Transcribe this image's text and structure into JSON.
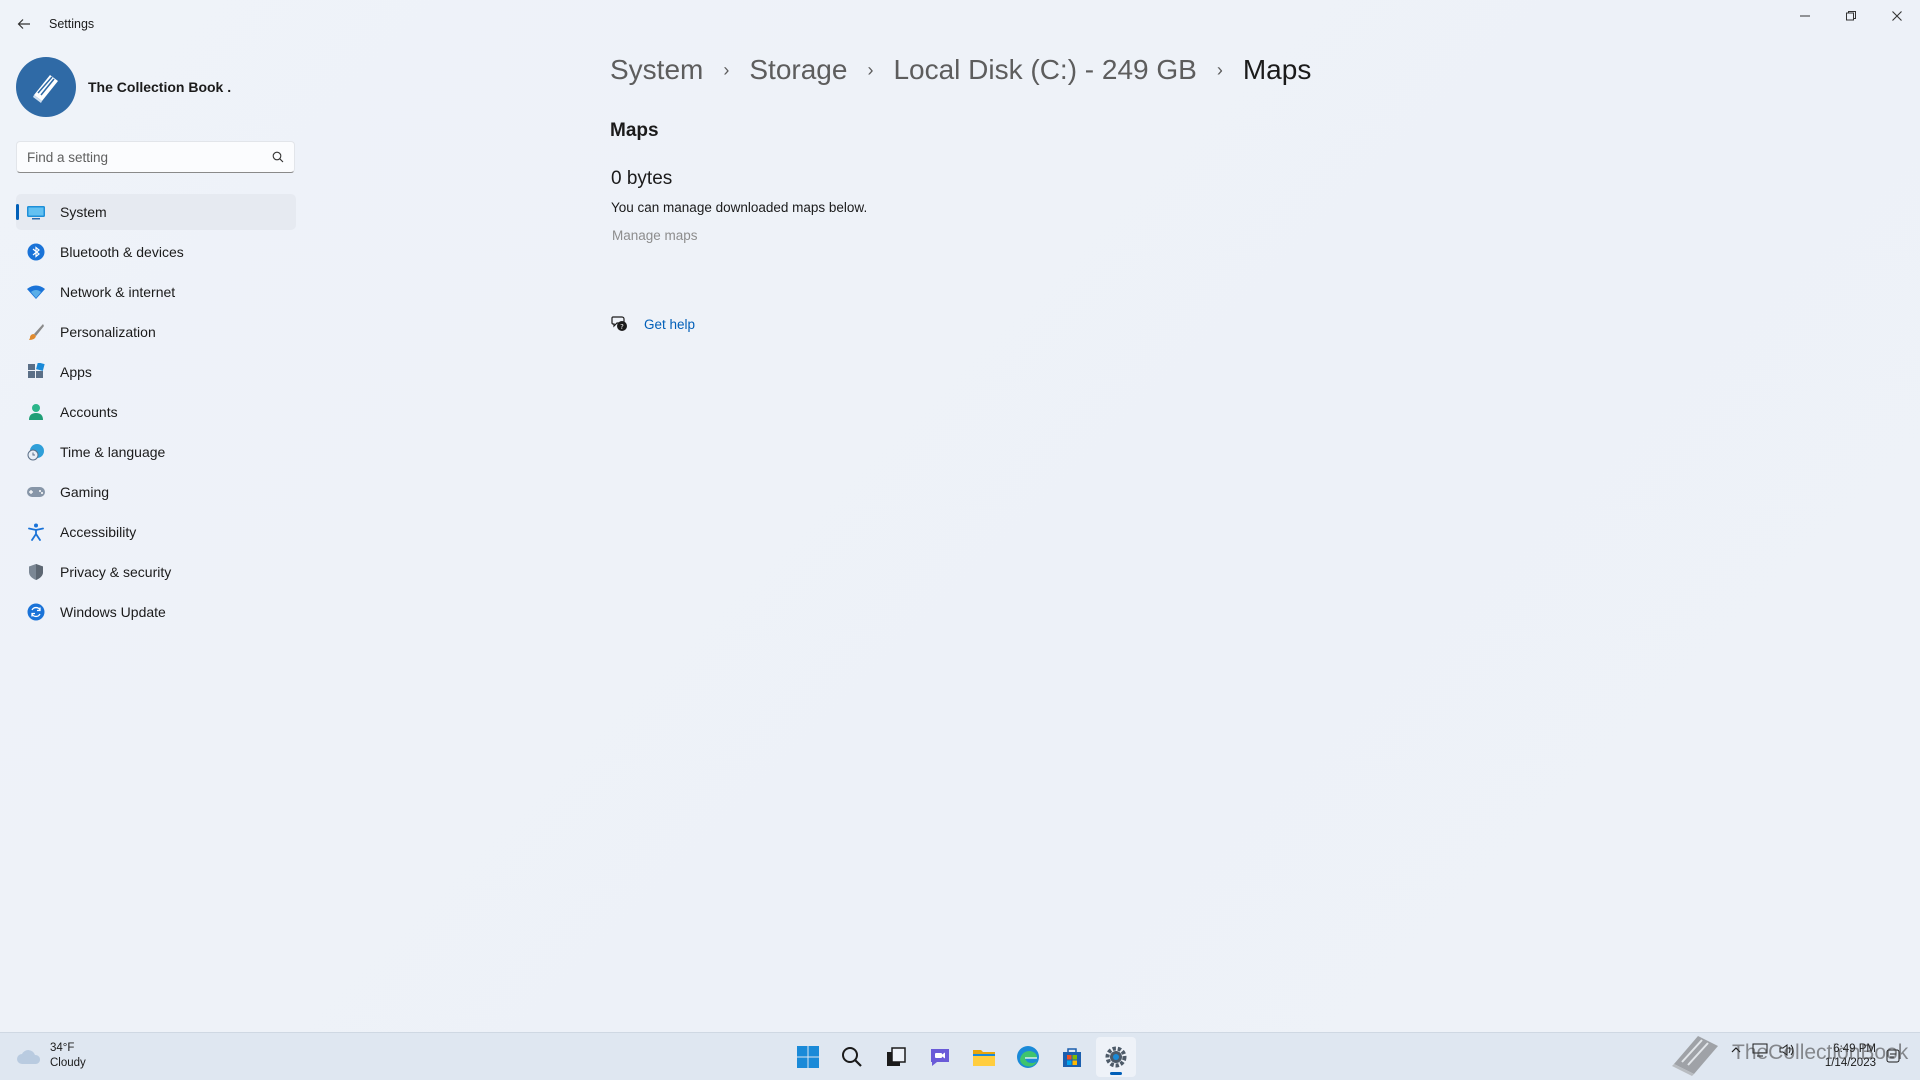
{
  "window": {
    "title": "Settings",
    "back_label": "←",
    "minimize_label": "—",
    "restore_label": "❐",
    "close_label": "✕"
  },
  "profile": {
    "name": "The Collection Book ."
  },
  "search": {
    "placeholder": "Find a setting"
  },
  "sidebar": {
    "items": [
      {
        "label": "System",
        "icon": "system-icon",
        "active": true
      },
      {
        "label": "Bluetooth & devices",
        "icon": "bluetooth-icon"
      },
      {
        "label": "Network & internet",
        "icon": "wifi-icon"
      },
      {
        "label": "Personalization",
        "icon": "brush-icon"
      },
      {
        "label": "Apps",
        "icon": "apps-icon"
      },
      {
        "label": "Accounts",
        "icon": "account-icon"
      },
      {
        "label": "Time & language",
        "icon": "globe-clock-icon"
      },
      {
        "label": "Gaming",
        "icon": "gamepad-icon"
      },
      {
        "label": "Accessibility",
        "icon": "accessibility-icon"
      },
      {
        "label": "Privacy & security",
        "icon": "shield-icon"
      },
      {
        "label": "Windows Update",
        "icon": "update-icon"
      }
    ]
  },
  "breadcrumb": {
    "items": [
      "System",
      "Storage",
      "Local Disk (C:) - 249 GB",
      "Maps"
    ],
    "separator": "›"
  },
  "main": {
    "section_title": "Maps",
    "size": "0 bytes",
    "description": "You can manage downloaded maps below.",
    "manage_link": "Manage maps",
    "help_label": "Get help"
  },
  "taskbar": {
    "weather_temp": "34°F",
    "weather_cond": "Cloudy",
    "time": "6:49 PM",
    "date": "1/14/2023",
    "watermark": "TheCollectionBook"
  },
  "colors": {
    "accent": "#005fb8",
    "background": "#eef2f8",
    "text": "#1b1b1b",
    "muted": "#8d8d8d"
  }
}
